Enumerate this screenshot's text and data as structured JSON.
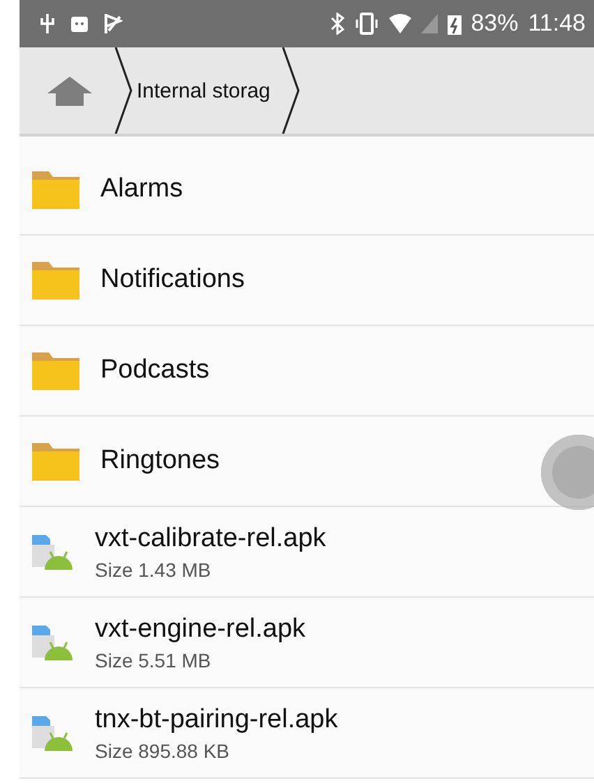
{
  "status_bar": {
    "battery": "83%",
    "time": "11:48"
  },
  "breadcrumb": {
    "items": [
      "Internal storag"
    ]
  },
  "files": [
    {
      "kind": "folder",
      "name": "Alarms"
    },
    {
      "kind": "folder",
      "name": "Notifications"
    },
    {
      "kind": "folder",
      "name": "Podcasts"
    },
    {
      "kind": "folder",
      "name": "Ringtones"
    },
    {
      "kind": "apk",
      "name": "vxt-calibrate-rel.apk",
      "size": "Size 1.43 MB"
    },
    {
      "kind": "apk",
      "name": "vxt-engine-rel.apk",
      "size": "Size 5.51 MB"
    },
    {
      "kind": "apk",
      "name": "tnx-bt-pairing-rel.apk",
      "size": "Size 895.88 KB"
    }
  ]
}
